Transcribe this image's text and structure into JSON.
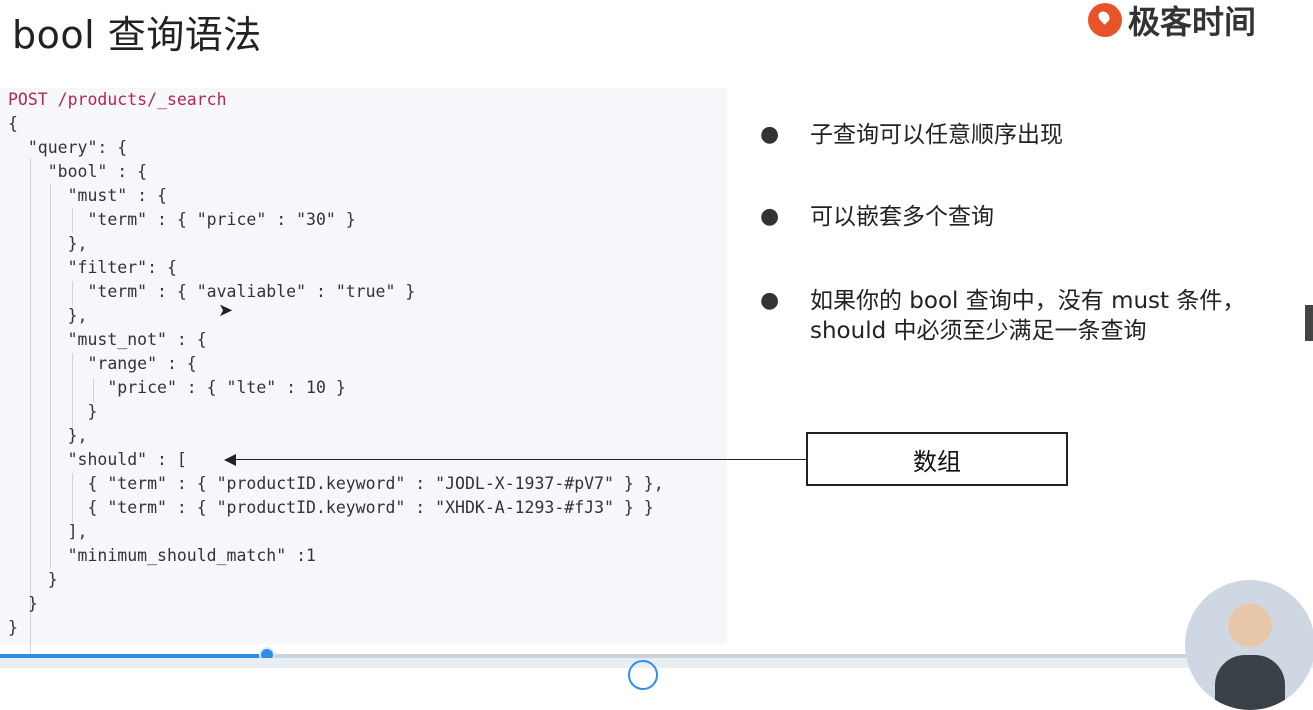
{
  "slide": {
    "title": "bool 查询语法",
    "logo_text": "极客时间"
  },
  "code": {
    "lines": [
      "POST /products/_search",
      "{",
      "  \"query\": {",
      "    \"bool\" : {",
      "      \"must\" : {",
      "        \"term\" : { \"price\" : \"30\" }",
      "      },",
      "      \"filter\": {",
      "        \"term\" : { \"avaliable\" : \"true\" }",
      "      },",
      "      \"must_not\" : {",
      "        \"range\" : {",
      "          \"price\" : { \"lte\" : 10 }",
      "        }",
      "      },",
      "      \"should\" : [",
      "        { \"term\" : { \"productID.keyword\" : \"JODL-X-1937-#pV7\" } },",
      "        { \"term\" : { \"productID.keyword\" : \"XHDK-A-1293-#fJ3\" } }",
      "      ],",
      "      \"minimum_should_match\" :1",
      "    }",
      "  }",
      "}"
    ]
  },
  "bullets": [
    {
      "text": "子查询可以任意顺序出现"
    },
    {
      "text": "可以嵌套多个查询"
    },
    {
      "text": "如果你的 bool 查询中，没有 must 条件，should 中必须至少满足一条查询"
    }
  ],
  "callout": {
    "label": "数组"
  },
  "player": {
    "progress_fraction": 0.203
  },
  "colors": {
    "accent": "#2d8ee8",
    "logo": "#e8542a",
    "code_background": "#f5f7fa"
  },
  "icons": {
    "logo": "geek-time-logo-icon",
    "bullet": "bullet-dot-icon",
    "arrow": "arrow-left-icon",
    "cursor": "mouse-cursor-icon"
  }
}
